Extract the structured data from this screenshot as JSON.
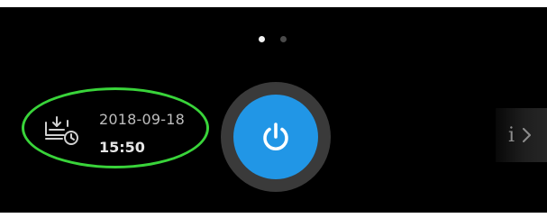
{
  "pager": {
    "pages": 2,
    "active_index": 0
  },
  "schedule": {
    "icon": "tub-download-clock-icon",
    "date": "2018-09-18",
    "time": "15:50"
  },
  "power": {
    "icon": "power-icon"
  },
  "info": {
    "label": "i",
    "icon": "chevron-right-icon"
  },
  "colors": {
    "background": "#000000",
    "highlight_ellipse": "#39d43a",
    "power_button": "#2196e6",
    "power_ring": "#3a3a3a",
    "dot_active": "#f2f2f2",
    "dot_inactive": "#4a4a4a"
  }
}
